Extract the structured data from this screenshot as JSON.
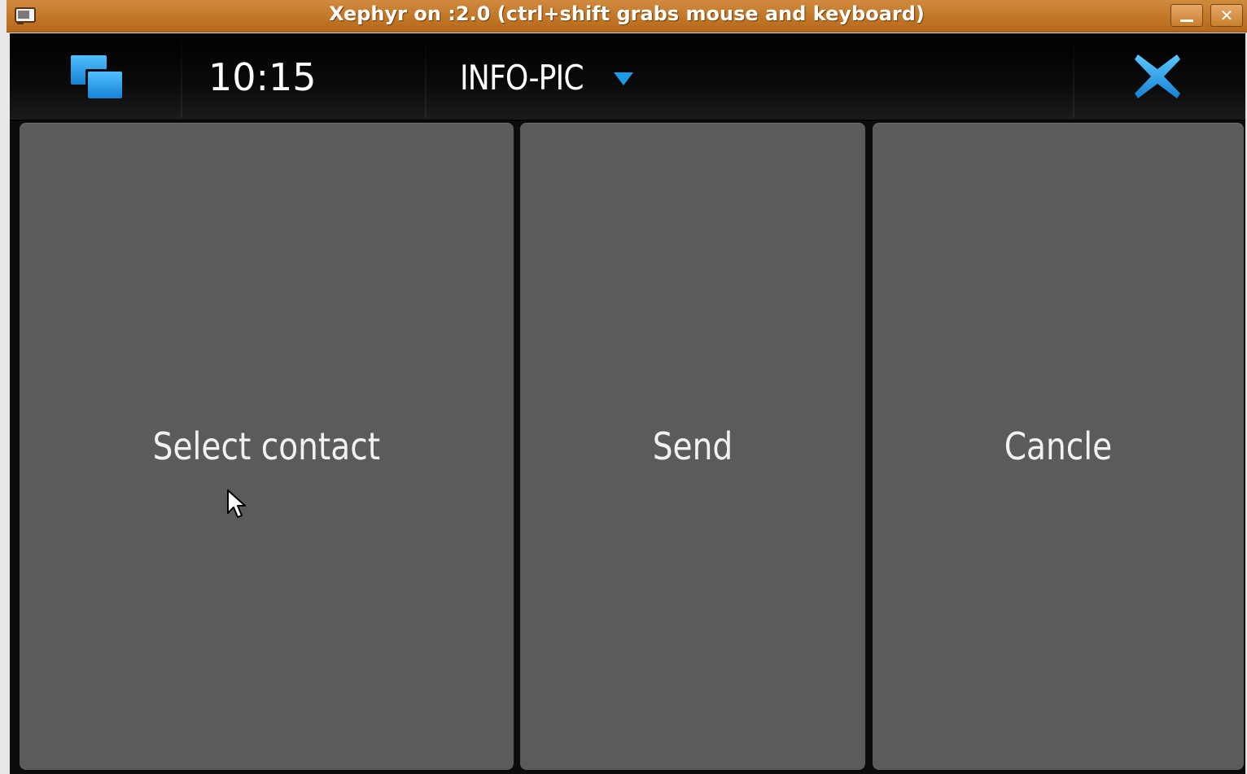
{
  "window": {
    "title": "Xephyr on :2.0 (ctrl+shift grabs mouse and keyboard)",
    "minimize_label": "",
    "close_label": "✕"
  },
  "statusbar": {
    "time": "10:15",
    "app_menu_label": "INFO-PIC",
    "accent_color": "#1e9be6"
  },
  "actions": {
    "select_contact_label": "Select contact",
    "send_label": "Send",
    "cancel_label": "Cancle"
  },
  "icons": {
    "task_switcher": "task-switcher-icon",
    "menu_arrow": "dropdown-arrow-icon",
    "close": "close-icon",
    "cursor": "mouse-pointer-icon"
  }
}
